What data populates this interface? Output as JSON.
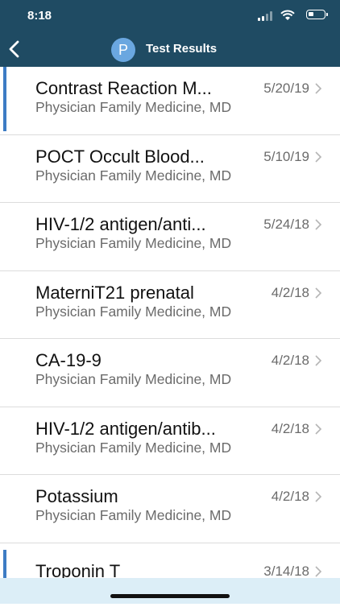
{
  "status_bar": {
    "time": "8:18"
  },
  "header": {
    "title": "Test Results",
    "avatar_letter": "P"
  },
  "results": [
    {
      "title": "Contrast Reaction M...",
      "provider": "Physician Family Medicine, MD",
      "date": "5/20/19",
      "unread": true
    },
    {
      "title": "POCT Occult Blood...",
      "provider": "Physician Family Medicine, MD",
      "date": "5/10/19",
      "unread": false
    },
    {
      "title": "HIV-1/2 antigen/anti...",
      "provider": "Physician Family Medicine, MD",
      "date": "5/24/18",
      "unread": false
    },
    {
      "title": "MaterniT21 prenatal",
      "provider": "Physician Family Medicine, MD",
      "date": "4/2/18",
      "unread": false
    },
    {
      "title": "CA-19-9",
      "provider": "Physician Family Medicine, MD",
      "date": "4/2/18",
      "unread": false
    },
    {
      "title": "HIV-1/2 antigen/antib...",
      "provider": "Physician Family Medicine, MD",
      "date": "4/2/18",
      "unread": false
    },
    {
      "title": "Potassium",
      "provider": "Physician Family Medicine, MD",
      "date": "4/2/18",
      "unread": false
    },
    {
      "title": "Troponin T",
      "provider": "",
      "date": "3/14/18",
      "unread": true
    }
  ],
  "colors": {
    "header": "#1f4b63",
    "unread_marker": "#3d7cc4",
    "avatar": "#6aa7e0"
  }
}
